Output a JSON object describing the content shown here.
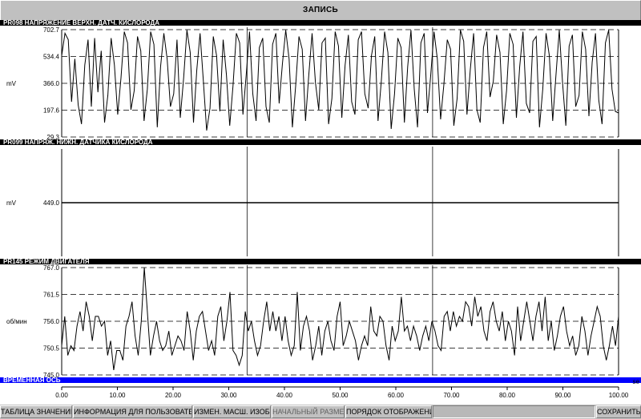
{
  "window": {
    "title": "ЗАПИСЬ"
  },
  "chart_data": [
    {
      "type": "line",
      "title": "PR098 НАПРЯЖЕНИЕ ВЕРХН. ДАТЧ. КИСЛОРОДА",
      "ylabel": "mV",
      "ylim": [
        29.3,
        702.7
      ],
      "yticks": [
        "702.7",
        "534.4",
        "366.0",
        "197.6",
        "29.3"
      ],
      "series": [
        {
          "values": [
            540,
            680,
            640,
            250,
            520,
            230,
            110,
            480,
            640,
            220,
            650,
            310,
            570,
            120,
            290,
            650,
            480,
            170,
            400,
            690,
            620,
            200,
            320,
            660,
            570,
            130,
            330,
            690,
            610,
            90,
            470,
            680,
            520,
            220,
            300,
            640,
            150,
            400,
            700,
            560,
            120,
            450,
            680,
            380,
            70,
            210,
            660,
            540,
            190,
            640,
            420,
            100,
            350,
            680,
            620,
            170,
            420,
            690,
            300,
            130,
            590,
            650,
            220,
            120,
            610,
            680,
            240,
            490,
            700,
            520,
            90,
            350,
            660,
            580,
            130,
            420,
            680,
            370,
            200,
            620,
            650,
            110,
            270,
            690,
            600,
            150,
            480,
            670,
            250,
            170,
            640,
            690,
            300,
            210,
            540,
            660,
            130,
            380,
            690,
            560,
            80,
            300,
            650,
            590,
            120,
            470,
            700,
            330,
            90,
            620,
            680,
            180,
            420,
            690,
            520,
            140,
            360,
            640,
            580,
            100,
            270,
            700,
            630,
            170,
            450,
            680,
            200,
            120,
            590,
            690,
            280,
            380,
            670,
            560,
            110,
            320,
            680,
            610,
            150,
            470,
            690,
            240,
            180,
            630,
            660,
            90,
            330,
            680,
            540,
            130,
            420,
            700,
            370,
            100,
            600,
            670,
            220,
            290,
            690,
            580,
            160,
            500,
            680,
            260,
            110,
            620,
            700,
            330,
            190,
            180
          ]
        }
      ]
    },
    {
      "type": "line",
      "title": "PR099 НАПРЯЖ. НИЖН. ДАТЧИКА КИСЛОРОДА",
      "ylabel": "mV",
      "yticks": [
        "449.0"
      ],
      "series": [
        {
          "values": [
            449.0,
            449.0
          ]
        }
      ]
    },
    {
      "type": "line",
      "title": "PR145 РЕЖИМ ДВИГАТЕЛЯ",
      "ylabel": "об/мин",
      "ylim": [
        745.0,
        767.0
      ],
      "yticks": [
        "767.0",
        "761.5",
        "756.0",
        "750.5",
        "745.0"
      ],
      "series": [
        {
          "values": [
            751,
            757,
            749,
            751,
            750,
            755,
            758,
            754,
            760,
            757,
            752,
            757,
            757,
            755,
            756,
            749,
            752,
            746,
            750,
            750,
            748,
            755,
            757,
            760,
            753,
            749,
            756,
            767,
            758,
            749,
            753,
            756,
            752,
            750,
            751,
            754,
            749,
            751,
            753,
            752,
            750,
            758,
            754,
            748,
            754,
            757,
            758,
            754,
            750,
            752,
            749,
            757,
            759,
            752,
            756,
            762,
            750,
            749,
            747,
            749,
            758,
            754,
            756,
            752,
            749,
            751,
            756,
            760,
            754,
            758,
            754,
            757,
            752,
            757,
            752,
            749,
            751,
            762,
            750,
            755,
            757,
            754,
            748,
            751,
            755,
            749,
            754,
            756,
            752,
            750,
            757,
            760,
            751,
            753,
            756,
            754,
            752,
            748,
            751,
            753,
            751,
            759,
            754,
            753,
            757,
            756,
            751,
            748,
            755,
            752,
            754,
            761,
            754,
            755,
            752,
            755,
            753,
            750,
            753,
            755,
            752,
            756,
            754,
            751,
            750,
            757,
            758,
            754,
            758,
            755,
            757,
            756,
            760,
            759,
            755,
            761,
            757,
            759,
            754,
            752,
            758,
            760,
            756,
            754,
            758,
            752,
            756,
            754,
            749,
            759,
            752,
            756,
            760,
            756,
            752,
            757,
            760,
            754,
            761,
            752,
            756,
            750,
            753,
            757,
            759,
            754,
            751,
            753,
            749,
            751,
            757,
            754,
            749,
            753,
            756,
            759,
            757,
            751,
            748,
            751,
            755,
            751,
            757
          ]
        }
      ]
    },
    {
      "type": "line",
      "title": "ВРЕМЕННАЯ ОСЬ",
      "xlim": [
        0,
        100
      ],
      "xticks": [
        "0.00",
        "10.00",
        "20.00",
        "30.00",
        "40.00",
        "50.00",
        "60.00",
        "70.00",
        "80.00",
        "90.00",
        "100.00"
      ],
      "xunit": "se",
      "cursor_x": [
        33.3,
        66.6
      ]
    }
  ],
  "buttons": [
    {
      "label": "ТАБЛИЦА ЗНАЧЕНИЙ"
    },
    {
      "label": "ИНФОРМАЦИЯ ДЛЯ ПОЛЬЗОВАТЕЛЯ"
    },
    {
      "label": "ИЗМЕН. МАСШ. ИЗОБР."
    },
    {
      "label": "НАЧАЛЬНЫЙ РАЗМЕР"
    },
    {
      "label": "ПОРЯДОК ОТОБРАЖЕНИЯ"
    },
    {
      "label": ""
    },
    {
      "label": "СОХРАНИТЬ"
    }
  ]
}
